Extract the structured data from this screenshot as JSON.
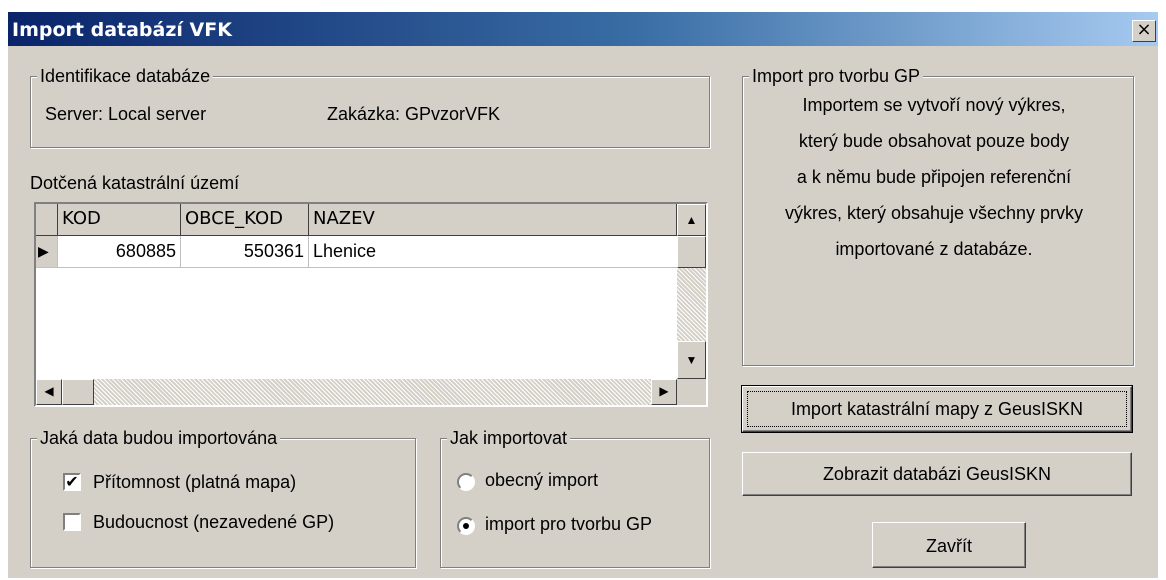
{
  "window": {
    "title": "Import databází VFK",
    "close_glyph": "×"
  },
  "identification": {
    "legend": "Identifikace databáze",
    "server": "Server: Local server",
    "order": "Zakázka: GPvzorVFK"
  },
  "territory": {
    "label": "Dotčená katastrální území",
    "columns": [
      "KOD",
      "OBCE_KOD",
      "NAZEV"
    ],
    "rows": [
      {
        "kod": "680885",
        "obce_kod": "550361",
        "nazev": "Lhenice"
      }
    ],
    "row_indicator": "▶"
  },
  "data_type": {
    "legend": "Jaká data budou importována",
    "options": [
      {
        "label": "Přítomnost (platná mapa)",
        "checked": true
      },
      {
        "label": "Budoucnost (nezavedené GP)",
        "checked": false
      }
    ],
    "check_glyph": "✔"
  },
  "import_mode": {
    "legend": "Jak importovat",
    "options": [
      {
        "label": "obecný import",
        "selected": false
      },
      {
        "label": "import pro tvorbu GP",
        "selected": true
      }
    ]
  },
  "gp_info": {
    "legend": "Import pro tvorbu GP",
    "lines": [
      "Importem se vytvoří  nový výkres,",
      "který bude obsahovat pouze body",
      "a k němu bude připojen referenční",
      "výkres, který obsahuje všechny prvky",
      "importované z databáze."
    ]
  },
  "buttons": {
    "import_map": "Import katastrální mapy z GeusISKN",
    "show_db": "Zobrazit databázi GeusISKN",
    "close": "Zavřít"
  },
  "scroll_glyphs": {
    "up": "▲",
    "down": "▼",
    "left": "◀",
    "right": "▶"
  }
}
